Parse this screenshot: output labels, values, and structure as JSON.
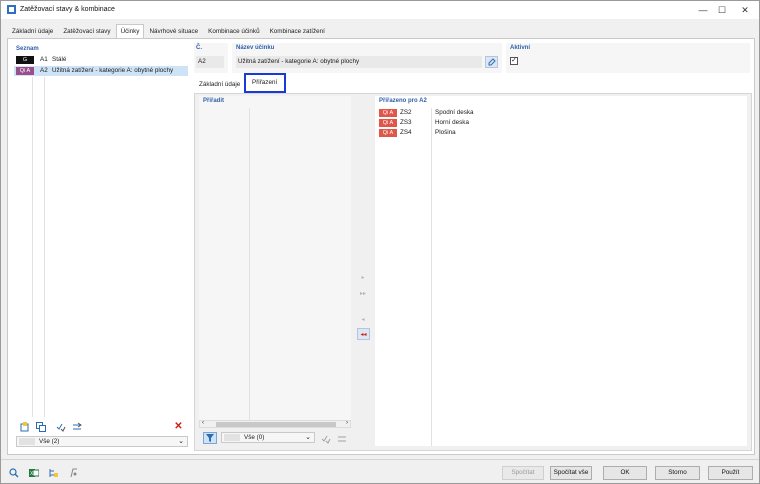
{
  "window": {
    "title": "Zatěžovací stavy & kombinace",
    "minimize": "—",
    "maximize": "☐",
    "close": "✕"
  },
  "tabs": [
    {
      "label": "Základní údaje"
    },
    {
      "label": "Zatěžovací stavy"
    },
    {
      "label": "Účinky"
    },
    {
      "label": "Návrhové situace"
    },
    {
      "label": "Kombinace účinků"
    },
    {
      "label": "Kombinace zatížení"
    }
  ],
  "list": {
    "header": "Seznam",
    "items": [
      {
        "tag": "G",
        "tag_color": "#111111",
        "number": "A1",
        "name": "Stálé"
      },
      {
        "tag": "Qi A",
        "tag_color": "#9a4f8a",
        "number": "A2",
        "name": "Užitná zatížení - kategorie A: obytné plochy"
      }
    ],
    "filter_value": "Vše (2)"
  },
  "header_fields": {
    "number_label": "Č.",
    "number_value": "A2",
    "name_label": "Název účinku",
    "name_value": "Užitná zatížení - kategorie A: obytné plochy",
    "active_label": "Aktivní"
  },
  "subtabs": [
    {
      "label": "Základní údaje"
    },
    {
      "label": "Přiřazení"
    }
  ],
  "assign": {
    "left_header": "Přiřadit",
    "right_header": "Přiřazeno pro A2",
    "assigned": [
      {
        "tag": "Qi A",
        "code": "ZS2",
        "name": "Spodní deska"
      },
      {
        "tag": "Qi A",
        "code": "ZS3",
        "name": "Horní deska"
      },
      {
        "tag": "Qi A",
        "code": "ZS4",
        "name": "Plošina"
      }
    ],
    "filter_value": "Vše (0)",
    "tag_color": "#e0574a"
  },
  "buttons": {
    "calculate": "Spočítat",
    "calculate_all": "Spočítat vše",
    "ok": "OK",
    "cancel": "Storno",
    "apply": "Použít"
  },
  "colors": {
    "accent": "#2f5fa8",
    "selection": "#cfe3f7",
    "focus_border": "#1a3ad6",
    "delete": "#d11919"
  }
}
